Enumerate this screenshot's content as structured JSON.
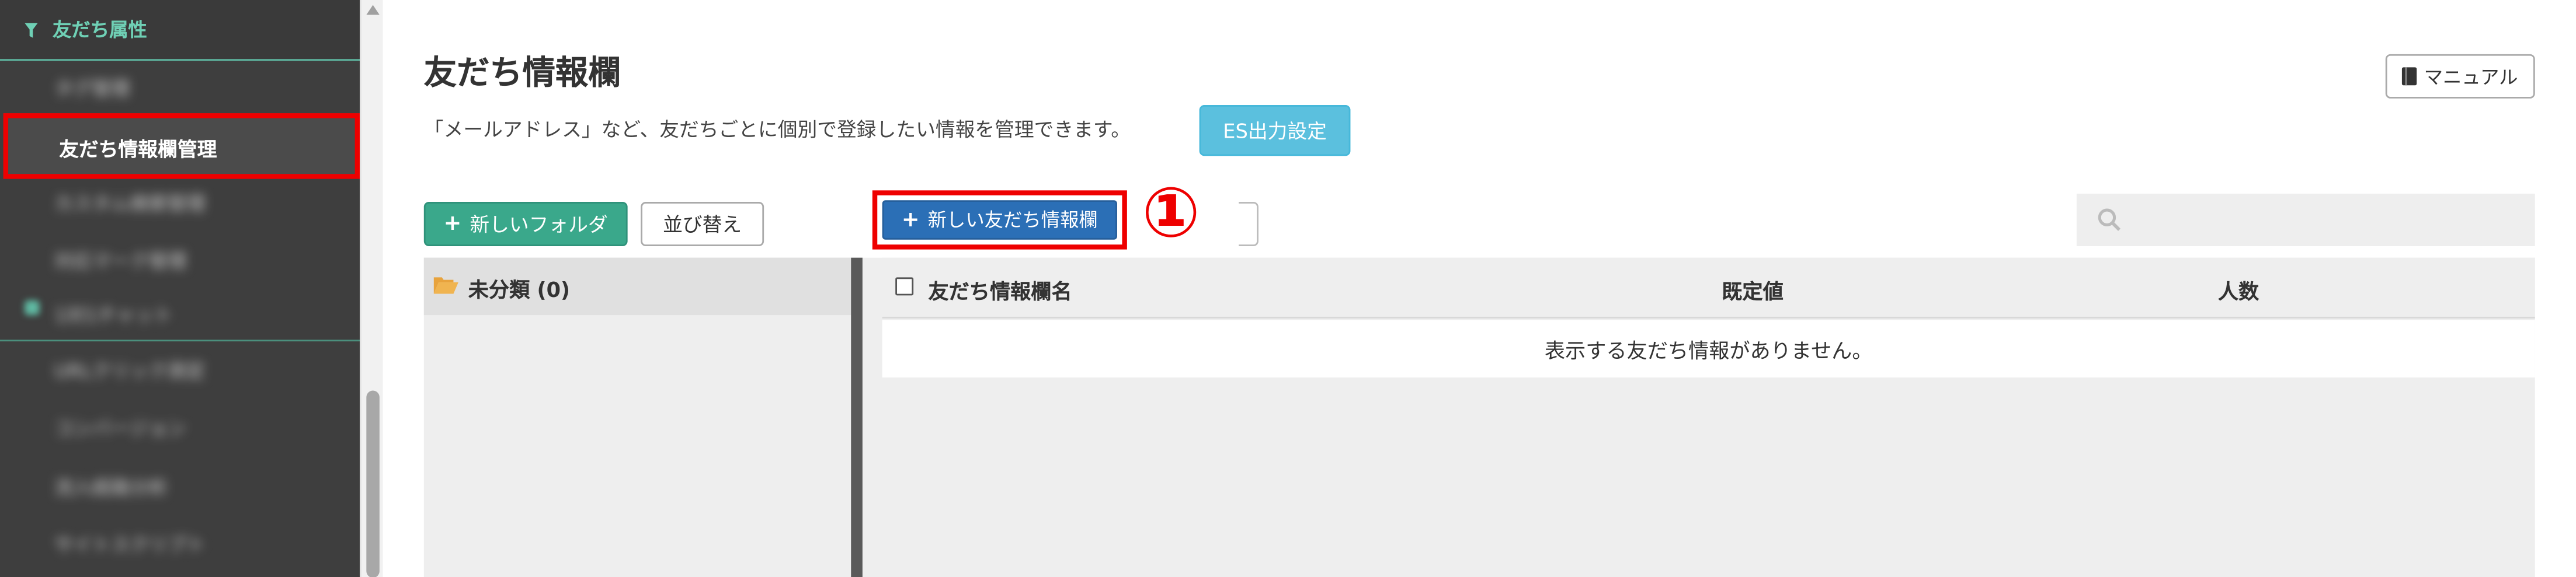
{
  "sidebar": {
    "section_title": "友だち属性",
    "items": [
      {
        "label": "タグ管理",
        "blurred": true
      },
      {
        "label": "友だち情報欄管理",
        "active": true
      },
      {
        "label": "カスタム検索管理",
        "blurred": true
      },
      {
        "label": "対応マーク管理",
        "blurred": true
      },
      {
        "label": "1対1チャット",
        "blurred": true
      },
      {
        "label": "URLクリック測定",
        "blurred": true
      },
      {
        "label": "コンバージョン",
        "blurred": true
      },
      {
        "label": "流入経路分析",
        "blurred": true
      },
      {
        "label": "サイトスクリプト",
        "blurred": true
      }
    ]
  },
  "page": {
    "title": "友だち情報欄",
    "description": "「メールアドレス」など、友だちごとに個別で登録したい情報を管理できます。",
    "es_button": "ES出力設定",
    "manual_button": "マニュアル"
  },
  "toolbar": {
    "new_folder": "新しいフォルダ",
    "sort": "並び替え",
    "new_info": "新しい友だち情報欄",
    "callout": "①",
    "search_placeholder": ""
  },
  "folders": [
    {
      "label": "未分類 (0)"
    }
  ],
  "table": {
    "columns": [
      "友だち情報欄名",
      "既定値",
      "人数"
    ],
    "empty_message": "表示する友だち情報がありません。"
  },
  "colors": {
    "accent_green": "#3aa88b",
    "info_blue": "#5bc0de",
    "primary_blue": "#2b6fb6",
    "highlight_red": "#ee0000",
    "sidebar_bg": "#3e3e3e"
  },
  "icons": [
    "filter-icon",
    "book-icon",
    "plus-icon",
    "search-icon",
    "folder-open-icon",
    "checkbox-icon"
  ]
}
